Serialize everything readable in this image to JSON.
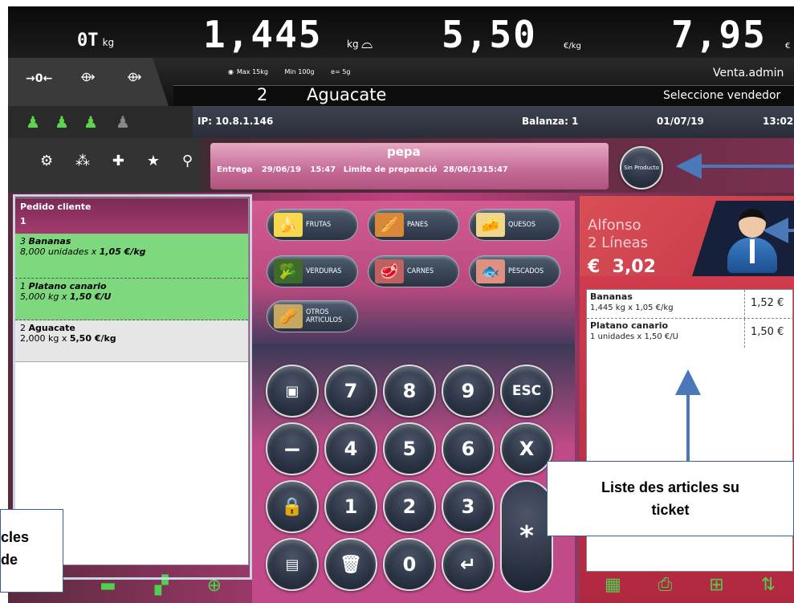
{
  "display": {
    "tare_value": "0T",
    "tare_unit": "kg",
    "weight_value": "1,445",
    "weight_unit": "kg",
    "price_value": "5,50",
    "price_unit": "€/kg",
    "total_value": "7,95",
    "total_unit": "€"
  },
  "scale_info": {
    "max": "Max 15kg",
    "min": "Min 100g",
    "e": "e= 5g"
  },
  "user": "Venta.admin",
  "product": {
    "number": "2",
    "name": "Aguacate"
  },
  "select_vendor": "Seleccione vendedor",
  "status": {
    "ip": "IP: 10.8.1.146",
    "scale": "Balanza: 1",
    "date": "01/07/19",
    "time": "13:02"
  },
  "zero_keys": {
    "zero": "→0←",
    "tare": "→T←",
    "preset_tare": "→PT←"
  },
  "vendors": [
    "1",
    "2",
    "3"
  ],
  "toolbar_icons": [
    "gear-icon",
    "share-icon",
    "plus-icon",
    "star-icon",
    "search-icon"
  ],
  "order_bar": {
    "customer": "pepa",
    "delivery_label": "Entrega",
    "delivery_date": "29/06/19",
    "delivery_time": "15:47",
    "limit_label": "Limite de preparació",
    "limit_date": "28/06/19",
    "limit_time": "15:47"
  },
  "no_product_button": "Sin Producto",
  "order_panel": {
    "title": "Pedido cliente",
    "number": "1",
    "items": [
      {
        "qty": "3",
        "name": "Bananas",
        "detail": "8,000 unidades x ",
        "price": "1,05 €/kg",
        "state": "done"
      },
      {
        "qty": "1",
        "name": "Platano canario",
        "detail": "5,000 kg x ",
        "price": "1,50 €/U",
        "state": "done"
      },
      {
        "qty": "2",
        "name": "Aguacate",
        "detail": "2,000 kg x ",
        "price": "5,50 €/kg",
        "state": "pending"
      }
    ]
  },
  "categories": [
    {
      "label": "FRUTAS",
      "icon": "banana-icon"
    },
    {
      "label": "PANES",
      "icon": "bread-icon"
    },
    {
      "label": "QUESOS",
      "icon": "cheese-icon"
    },
    {
      "label": "VERDURAS",
      "icon": "broccoli-icon"
    },
    {
      "label": "CARNES",
      "icon": "meat-icon"
    },
    {
      "label": "PESCADOS",
      "icon": "fish-icon"
    },
    {
      "label": "OTROS ARTICULOS",
      "icon": "nuts-icon"
    }
  ],
  "keypad": [
    "7",
    "8",
    "9",
    "ESC",
    "−",
    "4",
    "5",
    "6",
    "X",
    "1",
    "2",
    "3",
    "0",
    "*"
  ],
  "vendor_panel": {
    "name": "Alfonso",
    "lines": "2  Líneas",
    "currency": "€",
    "total": "3,02"
  },
  "ticket": [
    {
      "name": "Bananas",
      "detail": "1,445 kg x 1,05 €/kg",
      "price": "1,52 €"
    },
    {
      "name": "Platano canario",
      "detail": "1 unidades x 1,50 €/U",
      "price": "1,50 €"
    }
  ],
  "callouts": {
    "ticket_list": [
      "Liste des articles su",
      "ticket"
    ],
    "order_list": [
      "cles",
      "de"
    ]
  },
  "colors": {
    "done_row": "#7ed97e",
    "pending_row": "#e6e6e6",
    "arrow": "#4a78b8"
  }
}
